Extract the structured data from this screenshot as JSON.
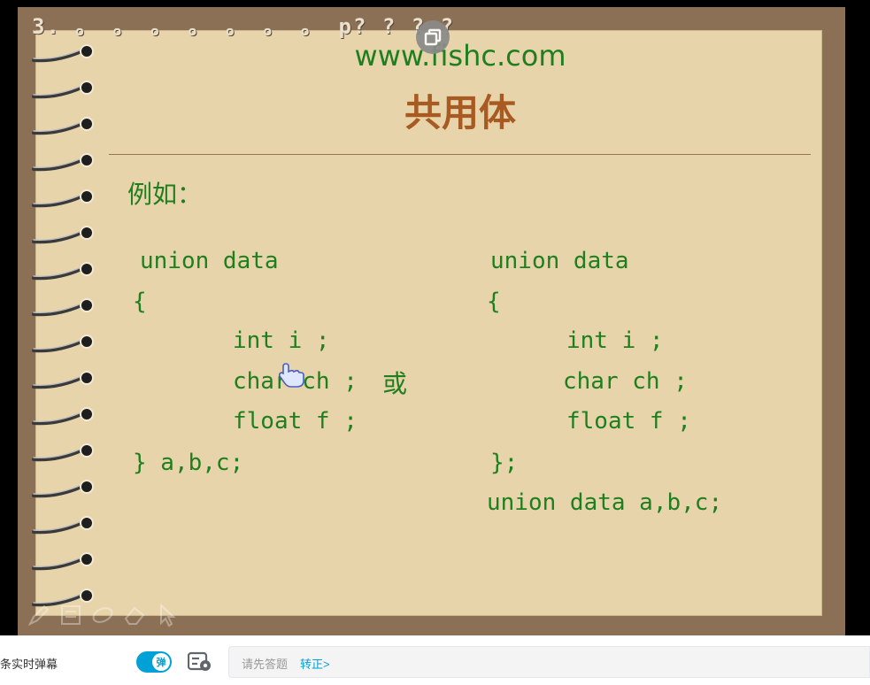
{
  "video": {
    "slide_title": "3. 。 。 。 。 。 。 。 p? ? ? ?",
    "url": "www.fishc.com",
    "heading": "共用体",
    "example_label": "例如：",
    "code_left": {
      "line1": "union data",
      "line2": "{",
      "line3": "int i ;",
      "line4": "char ch ;",
      "line5": "float f ;",
      "line6": "} a,b,c;"
    },
    "or_word": "或",
    "code_right": {
      "line1": "union data",
      "line2": "{",
      "line3": "int i ;",
      "line4": "char ch ;",
      "line5": "float f ;",
      "line6": "};",
      "line7": "union data a,b,c;"
    }
  },
  "barrage": {
    "count_text": "条实时弹幕",
    "toggle_label": "弹",
    "input_placeholder": "请先答题",
    "input_link": "转正>"
  },
  "colors": {
    "paper": "#e8d4aa",
    "frame": "#8c7055",
    "code_green": "#1f7f1f",
    "heading_brown": "#a85a23",
    "accent_blue": "#00a1d6"
  }
}
